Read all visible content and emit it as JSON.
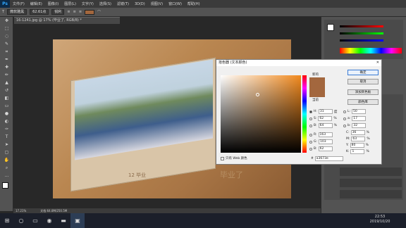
{
  "menubar": {
    "items": [
      "Ps",
      "文件(F)",
      "编辑(E)",
      "图像(I)",
      "图层(L)",
      "文字(Y)",
      "选择(S)",
      "滤镜(T)",
      "3D(D)",
      "视图(V)",
      "窗口(W)",
      "帮助(H)"
    ]
  },
  "options": {
    "font": "微软雅黑",
    "size": "62.61点",
    "aa": "锐利"
  },
  "doc": {
    "tab": "16-1241.jpg @ 17% (毕业了, RGB/8) *"
  },
  "canvas": {
    "card_text": "12 毕业",
    "wood_text": "毕业了"
  },
  "status": {
    "zoom": "17.21%",
    "doc": "文档:64.8M/250.5M"
  },
  "dialog": {
    "title": "拾色器 (文本颜色)",
    "new_label": "新的",
    "current_label": "当前",
    "ok": "确定",
    "cancel": "取消",
    "add_swatch": "添加到色板",
    "color_lib": "颜色库",
    "web_only": "只有 Web 颜色",
    "hsb": [
      {
        "k": "H:",
        "v": "31",
        "u": "度"
      },
      {
        "k": "S:",
        "v": "62",
        "u": "%"
      },
      {
        "k": "B:",
        "v": "64",
        "u": "%"
      }
    ],
    "rgb": [
      {
        "k": "R:",
        "v": "163",
        "u": ""
      },
      {
        "k": "G:",
        "v": "103",
        "u": ""
      },
      {
        "k": "B:",
        "v": "62",
        "u": ""
      }
    ],
    "lab": [
      {
        "k": "L:",
        "v": "50",
        "u": ""
      },
      {
        "k": "a:",
        "v": "17",
        "u": ""
      },
      {
        "k": "b:",
        "v": "32",
        "u": ""
      }
    ],
    "cmyk": [
      {
        "k": "C:",
        "v": "36",
        "u": "%"
      },
      {
        "k": "M:",
        "v": "63",
        "u": "%"
      },
      {
        "k": "Y:",
        "v": "80",
        "u": "%"
      },
      {
        "k": "K:",
        "v": "1",
        "u": "%"
      }
    ],
    "hex": "a3673e"
  },
  "taskbar": {
    "time": "22:53",
    "date": "2019/10/20"
  },
  "colors": {
    "picked": "#a3673e"
  }
}
